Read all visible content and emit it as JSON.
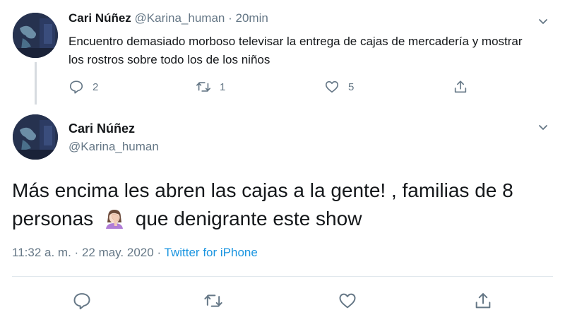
{
  "tweet1": {
    "name": "Cari Núñez",
    "handle": "@Karina_human",
    "separator": "·",
    "time": "20min",
    "text": "Encuentro demasiado morboso televisar la entrega de cajas de mercadería y mostrar los rostros sobre todo los de los niños",
    "replies": "2",
    "retweets": "1",
    "likes": "5"
  },
  "tweet2": {
    "name": "Cari Núñez",
    "handle": "@Karina_human",
    "text_before": "Más encima les abren las cajas a la gente! , familias de 8 personas",
    "text_after": "que denigrante este show",
    "time": "11:32 a. m.",
    "separator1": "·",
    "date": "22 may. 2020",
    "separator2": "·",
    "source": "Twitter for iPhone"
  },
  "icons": {
    "reply": "reply-icon",
    "retweet": "retweet-icon",
    "like": "heart-icon",
    "share": "share-icon",
    "chevron": "chevron-down-icon",
    "emoji": "facepalm-woman-emoji"
  },
  "colors": {
    "text": "#14171a",
    "muted": "#657786",
    "link": "#1b95e0",
    "divider": "#e1e8ed"
  }
}
